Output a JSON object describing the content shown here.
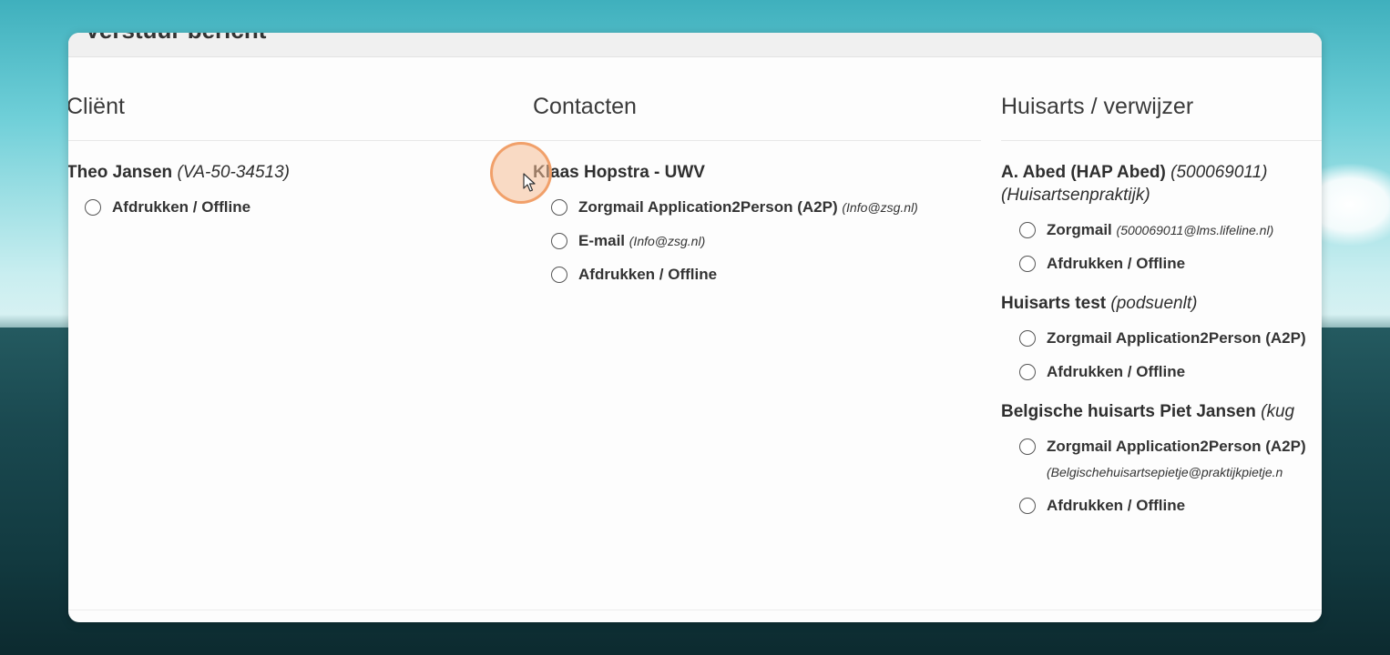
{
  "modal": {
    "title": "Verstuur bericht"
  },
  "columns": {
    "client": {
      "title": "Cliënt",
      "recipients": [
        {
          "name": "Theo Jansen",
          "id": "(VA-50-34513)",
          "options": [
            {
              "label": "Afdrukken / Offline"
            }
          ]
        }
      ]
    },
    "contacts": {
      "title": "Contacten",
      "recipients": [
        {
          "name": "Klaas Hopstra - UWV",
          "options": [
            {
              "label": "Zorgmail Application2Person (A2P)",
              "detail": "(Info@zsg.nl)"
            },
            {
              "label": "E-mail",
              "detail": "(Info@zsg.nl)"
            },
            {
              "label": "Afdrukken / Offline"
            }
          ]
        }
      ]
    },
    "gp": {
      "title": "Huisarts / verwijzer",
      "recipients": [
        {
          "name": "A. Abed (HAP Abed)",
          "id": "(500069011)",
          "org": "(Huisartsenpraktijk)",
          "options": [
            {
              "label": "Zorgmail",
              "detail": "(500069011@lms.lifeline.nl)"
            },
            {
              "label": "Afdrukken / Offline"
            }
          ]
        },
        {
          "name": "Huisarts test",
          "id": "(podsuenlt)",
          "options": [
            {
              "label": "Zorgmail Application2Person (A2P)"
            },
            {
              "label": "Afdrukken / Offline"
            }
          ]
        },
        {
          "name": "Belgische huisarts Piet Jansen",
          "id": "(kug",
          "options": [
            {
              "label": "Zorgmail Application2Person (A2P)",
              "detail": "(Belgischehuisartsepietje@praktijkpietje.n"
            },
            {
              "label": "Afdrukken / Offline"
            }
          ]
        }
      ]
    }
  },
  "colors": {
    "cursor_highlight": "#f3a56e",
    "text": "#333333"
  },
  "icons": {
    "cursor": "mouse-pointer-icon",
    "radio": "radio-button-icon"
  }
}
